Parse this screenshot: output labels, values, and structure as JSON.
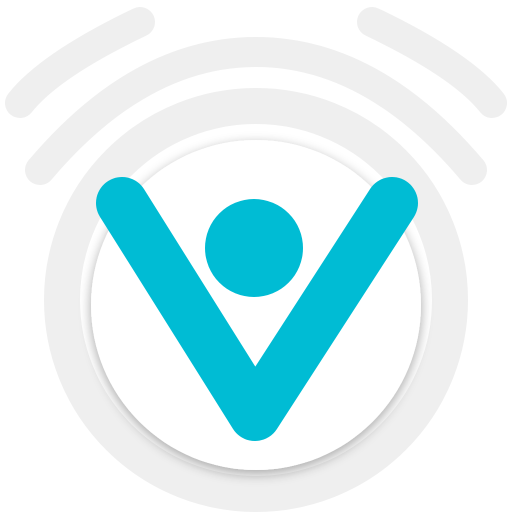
{
  "logo": {
    "icon_name": "v-person-signal-logo",
    "colors": {
      "accent": "#00BCD4",
      "ring": "#EFEFEF",
      "disc": "#FFFFFF",
      "disc_shadow": "#D9D9D9",
      "background": "#FFFFFF"
    }
  }
}
